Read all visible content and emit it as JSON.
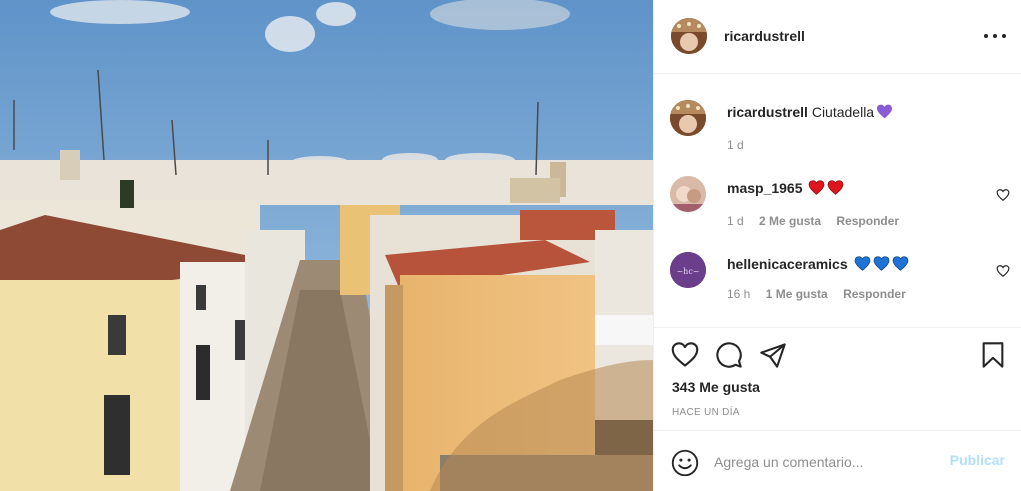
{
  "post": {
    "author": "ricardustrell",
    "caption": "Ciutadella",
    "caption_emoji": "purple-heart-emoji",
    "caption_time": "1 d"
  },
  "comments": [
    {
      "user": "masp_1965",
      "emoji": [
        "red-heart-emoji",
        "red-heart-emoji"
      ],
      "time": "1 d",
      "likes": "2 Me gusta",
      "reply": "Responder"
    },
    {
      "user": "hellenicaceramics",
      "emoji": [
        "blue-heart-emoji",
        "blue-heart-emoji",
        "blue-heart-emoji"
      ],
      "time": "16 h",
      "likes": "1 Me gusta",
      "reply": "Responder"
    }
  ],
  "actions": {
    "icons": [
      "heart-icon",
      "comment-icon",
      "share-icon",
      "bookmark-icon"
    ],
    "likes": "343 Me gusta",
    "time_ago": "HACE UN DÍA"
  },
  "add_comment": {
    "placeholder": "Agrega un comentario...",
    "publish": "Publicar",
    "icon": "smile-icon"
  },
  "colors": {
    "red_heart": "#e0151d",
    "blue_heart": "#1f73d6",
    "purple_heart": "#8a5bd6",
    "publish_disabled": "#b2dffc",
    "meta_gray": "#8e8e8e"
  }
}
